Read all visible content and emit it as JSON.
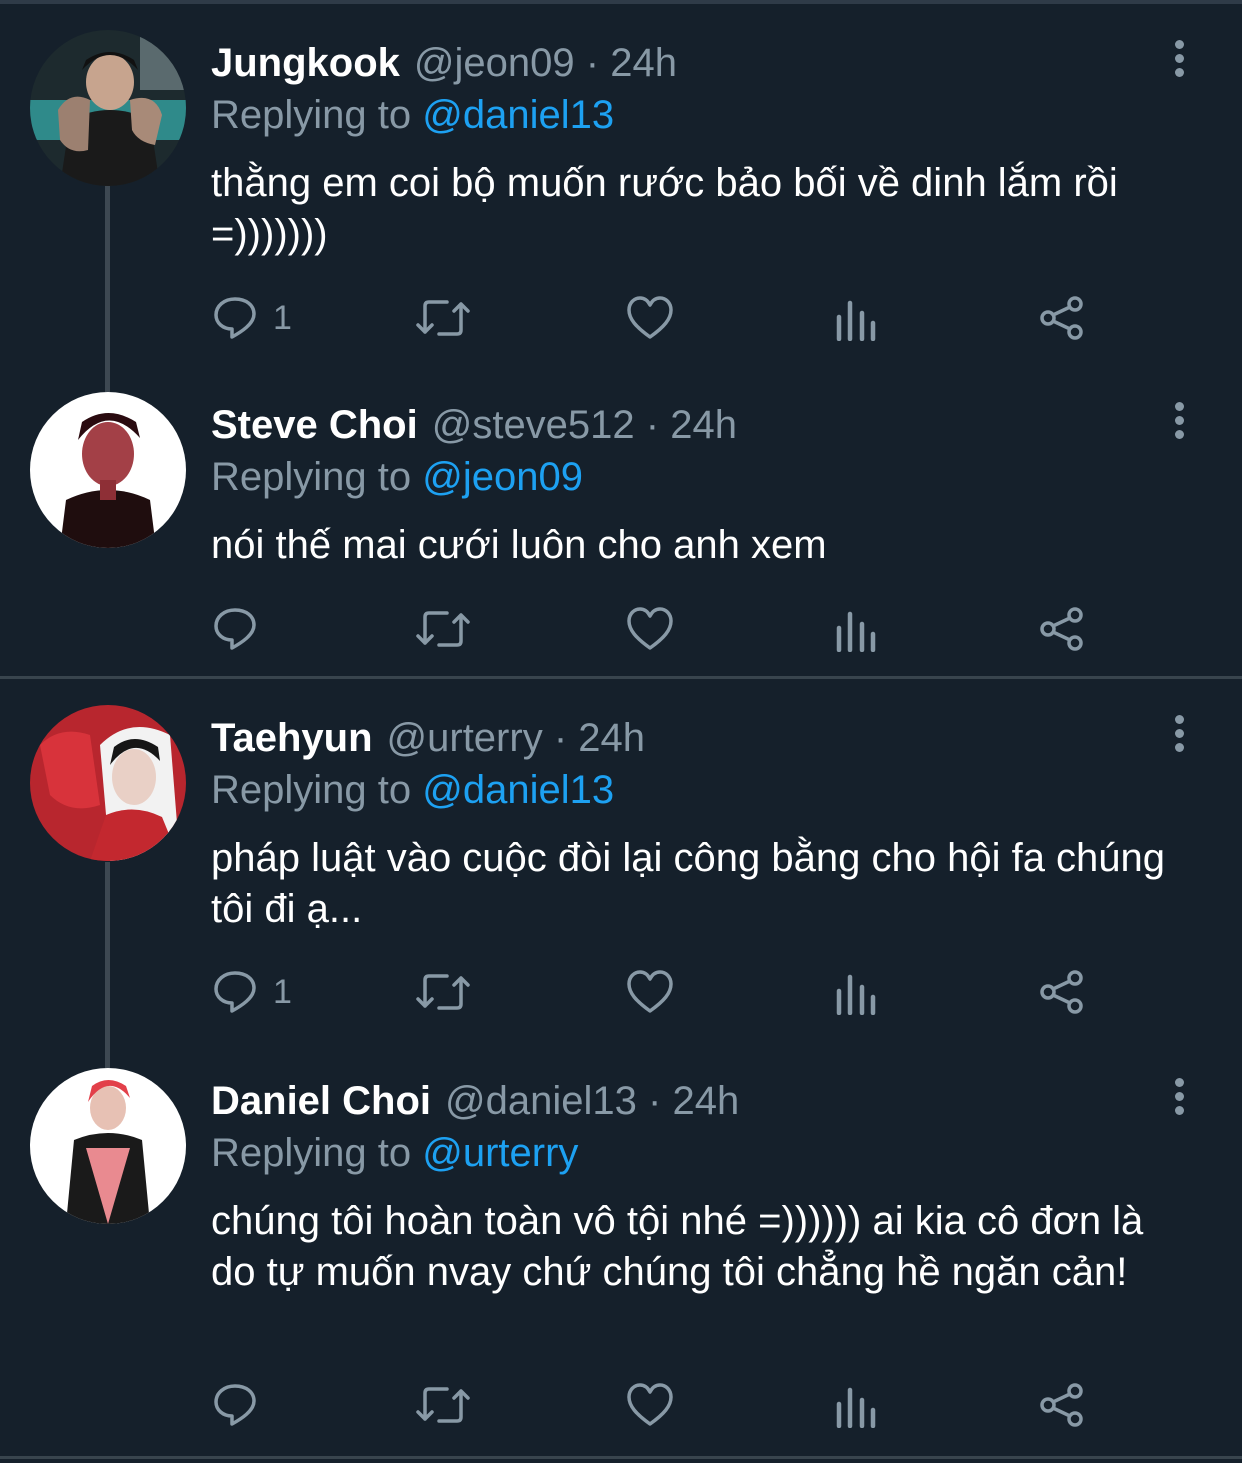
{
  "colors": {
    "background": "#15202b",
    "text": "#ffffff",
    "secondary": "#8899a6",
    "mention": "#1da1f2",
    "divider": "#38444d"
  },
  "separator": "·",
  "reply_prefix": "Replying to",
  "tweets": [
    {
      "name": "Jungkook",
      "handle": "@jeon09",
      "time": "24h",
      "reply_to": "@daniel13",
      "text": "thằng em coi bộ muốn rước bảo bối về dinh lắm rồi =)))))))",
      "reply_count": "1"
    },
    {
      "name": "Steve Choi",
      "handle": "@steve512",
      "time": "24h",
      "reply_to": "@jeon09",
      "text": "nói thế mai cưới luôn cho anh xem",
      "reply_count": ""
    },
    {
      "name": "Taehyun",
      "handle": "@urterry",
      "time": "24h",
      "reply_to": "@daniel13",
      "text": "pháp luật vào cuộc đòi lại công bằng cho hội fa chúng tôi đi ạ...",
      "reply_count": "1"
    },
    {
      "name": "Daniel Choi",
      "handle": "@daniel13",
      "time": "24h",
      "reply_to": "@urterry",
      "text": "chúng tôi hoàn toàn vô tội nhé =)))))) ai kia cô đơn là do tự muốn nvay chứ chúng tôi chẳng hề ngăn cản!",
      "reply_count": ""
    }
  ],
  "icons": {
    "reply": "reply-icon",
    "retweet": "retweet-icon",
    "like": "heart-icon",
    "analytics": "analytics-icon",
    "share": "share-icon",
    "more": "more-vertical-icon"
  }
}
